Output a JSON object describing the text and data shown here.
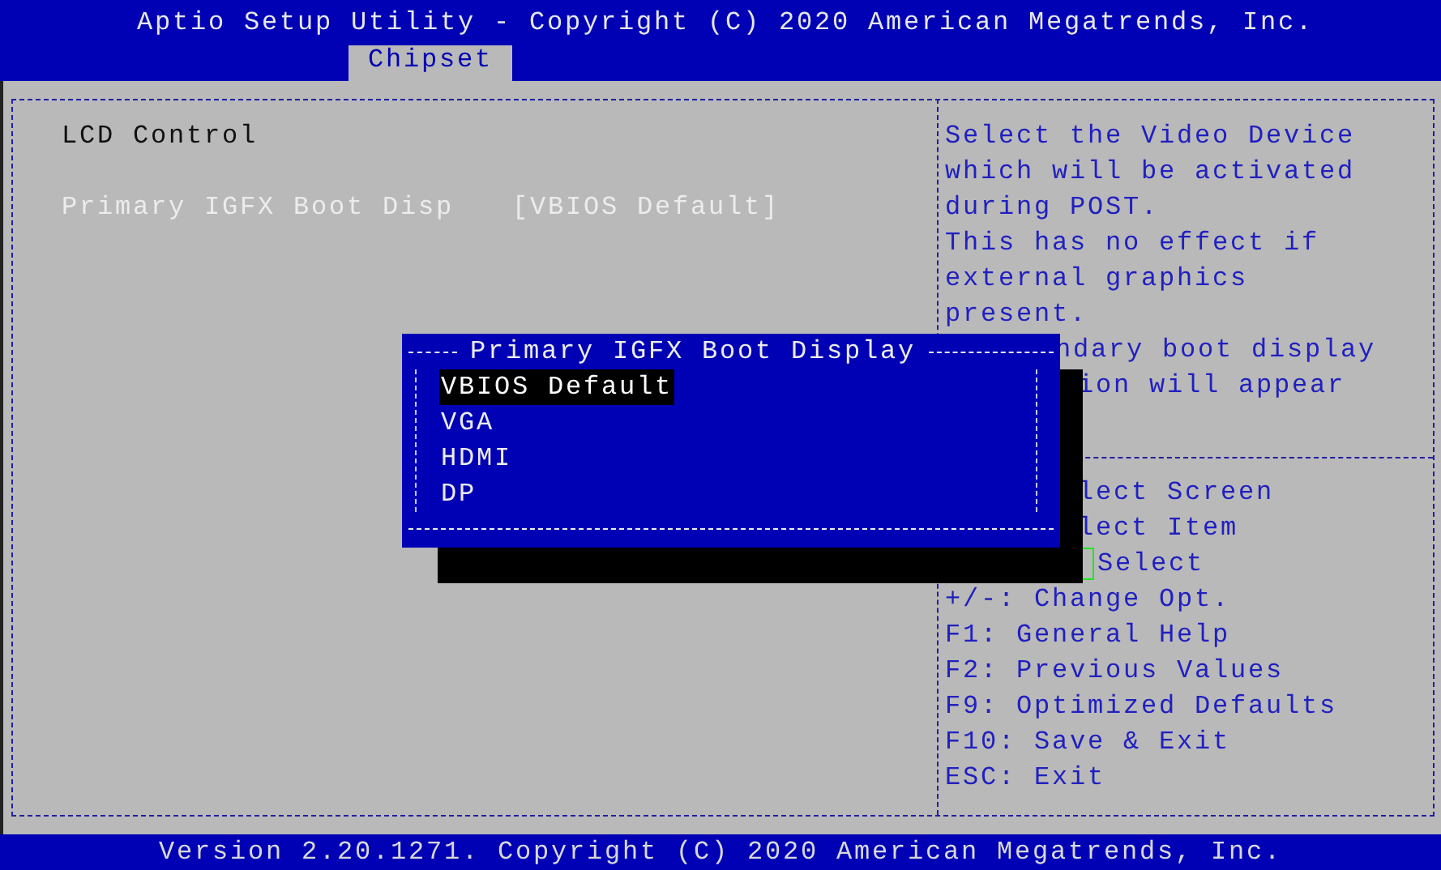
{
  "header": {
    "title": "Aptio Setup Utility - Copyright (C) 2020 American Megatrends, Inc.",
    "tabs": [
      {
        "label": "Chipset",
        "selected": true
      }
    ]
  },
  "settings": [
    {
      "kind": "subtitle",
      "label": "LCD Control"
    },
    {
      "kind": "blank"
    },
    {
      "kind": "option",
      "label": "Primary IGFX Boot Disp",
      "value": "[VBIOS Default]",
      "selected": true
    }
  ],
  "help": [
    {
      "kind": "text",
      "text": "Select the Video Device"
    },
    {
      "kind": "text",
      "text": "which will be activated"
    },
    {
      "kind": "text",
      "text": "during POST."
    },
    {
      "kind": "text",
      "text": "This has no effect if"
    },
    {
      "kind": "text",
      "text": "external graphics"
    },
    {
      "kind": "text",
      "text": "present."
    },
    {
      "kind": "covered",
      "text": "ndary boot display"
    },
    {
      "kind": "shadowed",
      "text": "ion will appear"
    },
    {
      "kind": "blank"
    },
    {
      "kind": "separator"
    },
    {
      "kind": "shadowed",
      "text": "lect Screen"
    },
    {
      "kind": "shadowed",
      "text": "lect Item"
    },
    {
      "kind": "shadowed",
      "text": "Select",
      "cursor": true
    },
    {
      "kind": "text",
      "text": "+/-: Change Opt."
    },
    {
      "kind": "text",
      "text": "F1: General Help"
    },
    {
      "kind": "text",
      "text": "F2: Previous Values"
    },
    {
      "kind": "text",
      "text": "F9: Optimized Defaults"
    },
    {
      "kind": "text",
      "text": "F10: Save & Exit"
    },
    {
      "kind": "text",
      "text": "ESC: Exit"
    }
  ],
  "popup": {
    "title": "Primary IGFX Boot Display",
    "options": [
      {
        "label": "VBIOS Default",
        "selected": true
      },
      {
        "label": "VGA",
        "selected": false
      },
      {
        "label": "HDMI",
        "selected": false
      },
      {
        "label": "DP",
        "selected": false
      }
    ]
  },
  "footer": {
    "text": "Version 2.20.1271. Copyright (C) 2020 American Megatrends, Inc."
  }
}
